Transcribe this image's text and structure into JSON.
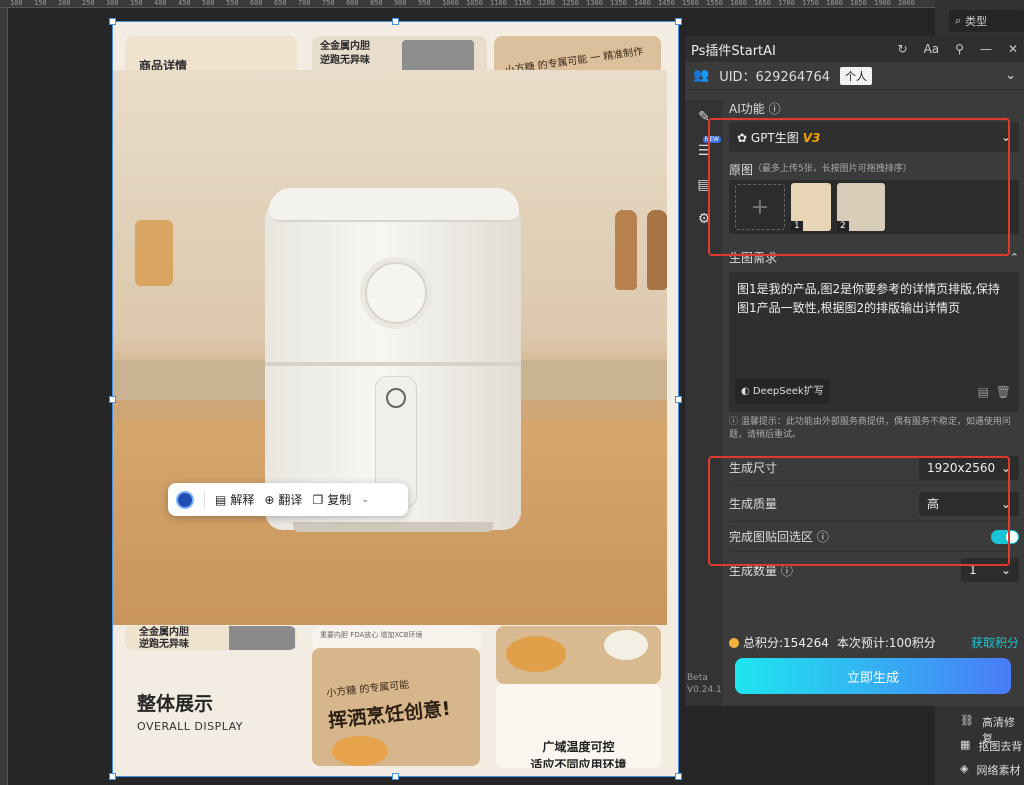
{
  "ruler": {
    "ticks": [
      "100",
      "150",
      "200",
      "250",
      "300",
      "350",
      "400",
      "450",
      "500",
      "550",
      "600",
      "650",
      "700",
      "750",
      "800",
      "850",
      "900",
      "950",
      "1000",
      "1050",
      "1100",
      "1150",
      "1200",
      "1250",
      "1300",
      "1350",
      "1400",
      "1450",
      "1500",
      "1550",
      "1600",
      "1650",
      "1700",
      "1750",
      "1800",
      "1850",
      "1900",
      "2000"
    ]
  },
  "canvas": {
    "tile_top_left": "商品详情",
    "tile_top_mid_1": "全金属内胆",
    "tile_top_mid_2": "逆跑无异味",
    "tile_top_right": "小方糖 的专属可能 一 精准制作",
    "bottom_left_1": "全金属内胆",
    "bottom_left_2": "逆跑无异味",
    "bottom_mid": "重要内胆 FDA放心  增加XCB环境",
    "section_title": "整体展示",
    "section_subtitle": "OVERALL DISPLAY",
    "slogan_small": "小方糖 的专属可能",
    "slogan_big": "挥洒烹饪创意!",
    "right_caption_1": "广域温度可控",
    "right_caption_2": "适应不同应用环境"
  },
  "float_toolbar": {
    "explain": "解释",
    "translate": "翻译",
    "copy": "复制"
  },
  "panel": {
    "title": "Ps插件StartAI",
    "uid": "UID：629264764",
    "uid_badge": "个人",
    "ai_function_label": "AI功能",
    "model": "GPT生图",
    "model_version": "V3",
    "new_badge": "NEW",
    "source_label": "原图",
    "source_hint": "（最多上传5张，长按图片可拖拽排序）",
    "thumb1": "1",
    "thumb2": "2",
    "prompt_label": "生图需求",
    "prompt_text": "图1是我的产品,图2是你要参考的详情页排版,保持图1产品一致性,根据图2的排版输出详情页",
    "deepseek_btn": "DeepSeek扩写",
    "tip_text": "温馨提示：此功能由外部服务商提供，偶有服务不稳定，如遇使用问题，请稍后重试。",
    "size_label": "生成尺寸",
    "size_value": "1920x2560",
    "quality_label": "生成质量",
    "quality_value": "高",
    "paste_label": "完成图贴回选区",
    "count_label": "生成数量",
    "count_value": "1",
    "total_credits": "总积分:154264",
    "estimate": "本次预计:100积分",
    "get_credits": "获取积分",
    "generate_btn": "立即生成",
    "beta": "Beta",
    "version": "V0.24.1"
  },
  "right_column": {
    "search_label": "类型",
    "item1": "高清修复",
    "item2": "抠图去背",
    "item3": "网络素材"
  },
  "colors": {
    "accent": "#19c4d6",
    "highlight": "#e03a2f",
    "selection": "#4a90e2"
  }
}
